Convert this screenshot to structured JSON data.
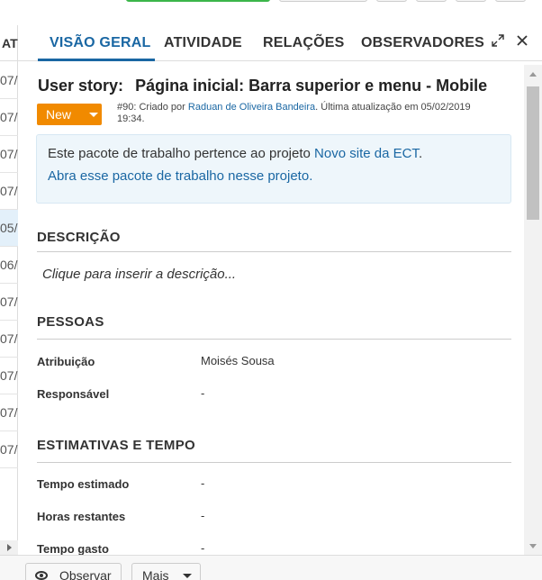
{
  "left_table": {
    "header": "AT",
    "cells": [
      "07/",
      "07/",
      "07/",
      "07/",
      "05/",
      "06/",
      "07/",
      "07/",
      "07/",
      "07/",
      "07/"
    ]
  },
  "tabs": [
    {
      "label": "VISÃO GERAL",
      "active": true
    },
    {
      "label": "ATIVIDADE",
      "active": false
    },
    {
      "label": "RELAÇÕES",
      "active": false
    },
    {
      "label": "OBSERVADORES",
      "active": false
    }
  ],
  "header_icons": {
    "expand": "expand-icon",
    "close": "close-icon"
  },
  "work_package": {
    "type": "User story:",
    "subject": "Página inicial: Barra superior e menu - Mobile",
    "status": "New",
    "meta_prefix": "#90: Criado por ",
    "author": "Raduan de Oliveira Bandeira",
    "meta_suffix": ". Última atualização em 05/02/2019",
    "meta_time": "19:34."
  },
  "info": {
    "text": "Este pacote de trabalho pertence ao projeto ",
    "project": "Novo site da ECT",
    "period": ".",
    "open_link": "Abra esse pacote de trabalho nesse projeto."
  },
  "description": {
    "heading": "DESCRIÇÃO",
    "placeholder": "Clique para inserir a descrição..."
  },
  "people": {
    "heading": "PESSOAS",
    "fields": [
      {
        "label": "Atribuição",
        "value": "Moisés Sousa"
      },
      {
        "label": "Responsável",
        "value": "-"
      }
    ]
  },
  "estimates": {
    "heading": "ESTIMATIVAS E TEMPO",
    "fields": [
      {
        "label": "Tempo estimado",
        "value": "-"
      },
      {
        "label": "Horas restantes",
        "value": "-"
      },
      {
        "label": "Tempo gasto",
        "value": "-"
      }
    ]
  },
  "footer": {
    "watch_label": "Observar",
    "more_label": "Mais"
  },
  "colors": {
    "accent": "#1a67a3",
    "status": "#f18a00",
    "info_bg": "#eef6fb"
  }
}
